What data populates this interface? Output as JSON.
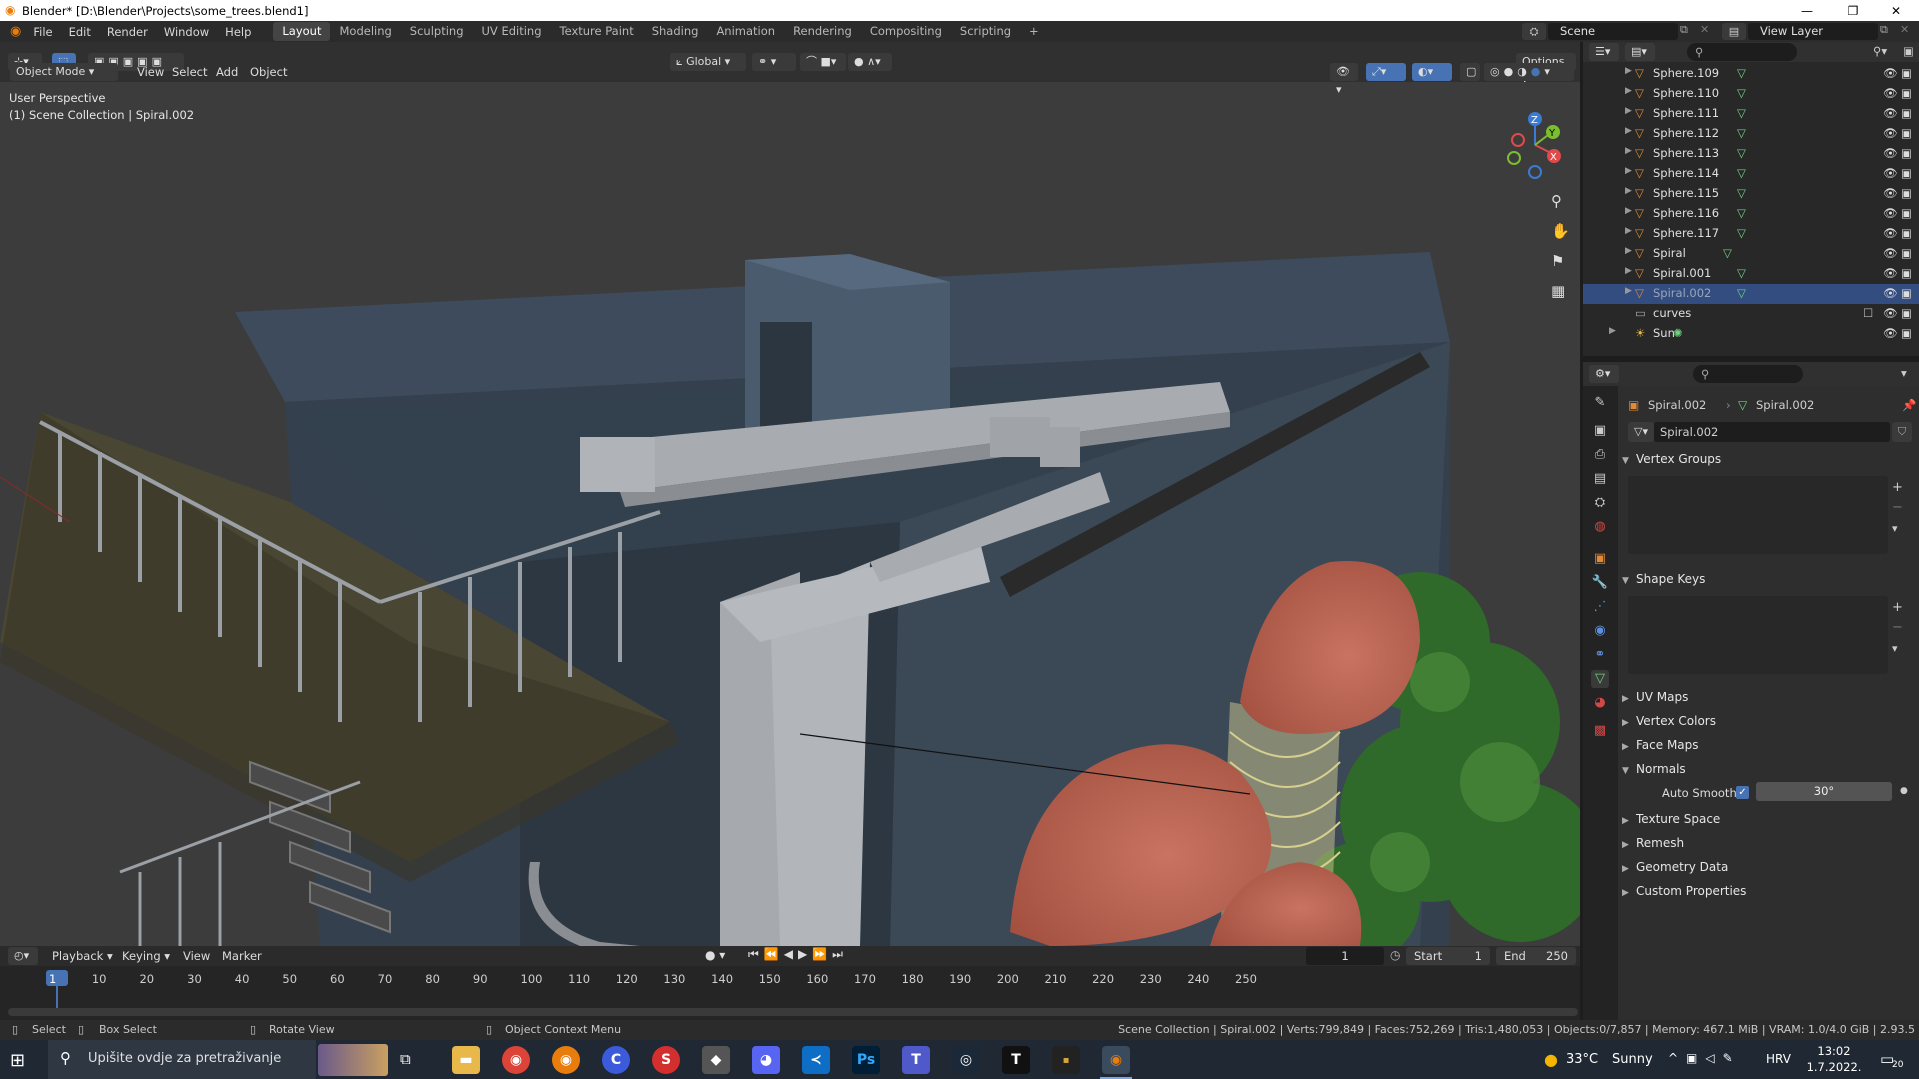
{
  "titlebar": {
    "title": "Blender* [D:\\Blender\\Projects\\some_trees.blend1]",
    "minimize": "—",
    "restore": "❐",
    "close": "✕"
  },
  "menus": [
    "File",
    "Edit",
    "Render",
    "Window",
    "Help"
  ],
  "workspaces": [
    {
      "label": "Layout",
      "active": true
    },
    {
      "label": "Modeling",
      "active": false
    },
    {
      "label": "Sculpting",
      "active": false
    },
    {
      "label": "UV Editing",
      "active": false
    },
    {
      "label": "Texture Paint",
      "active": false
    },
    {
      "label": "Shading",
      "active": false
    },
    {
      "label": "Animation",
      "active": false
    },
    {
      "label": "Rendering",
      "active": false
    },
    {
      "label": "Compositing",
      "active": false
    },
    {
      "label": "Scripting",
      "active": false
    }
  ],
  "add_workspace": "+",
  "scene": {
    "label": "Scene"
  },
  "view_layer": {
    "label": "View Layer"
  },
  "viewport_header": {
    "transform_orientation": "Global",
    "options": "Options",
    "mode": "Object Mode",
    "menus": [
      "View",
      "Select",
      "Add",
      "Object"
    ]
  },
  "viewport": {
    "perspective": "User Perspective",
    "collection": "(1) Scene Collection | Spiral.002"
  },
  "gizmo": {
    "z": "Z",
    "y": "Y",
    "x": "X"
  },
  "outliner": {
    "rows": [
      {
        "name": "Sphere.109",
        "type": "mesh",
        "selected": false
      },
      {
        "name": "Sphere.110",
        "type": "mesh",
        "selected": false
      },
      {
        "name": "Sphere.111",
        "type": "mesh",
        "selected": false
      },
      {
        "name": "Sphere.112",
        "type": "mesh",
        "selected": false
      },
      {
        "name": "Sphere.113",
        "type": "mesh",
        "selected": false
      },
      {
        "name": "Sphere.114",
        "type": "mesh",
        "selected": false
      },
      {
        "name": "Sphere.115",
        "type": "mesh",
        "selected": false
      },
      {
        "name": "Sphere.116",
        "type": "mesh",
        "selected": false
      },
      {
        "name": "Sphere.117",
        "type": "mesh",
        "selected": false
      },
      {
        "name": "Spiral",
        "type": "mesh",
        "selected": false
      },
      {
        "name": "Spiral.001",
        "type": "mesh",
        "selected": false
      },
      {
        "name": "Spiral.002",
        "type": "mesh",
        "selected": true
      },
      {
        "name": "curves",
        "type": "collection",
        "selected": false
      },
      {
        "name": "Sun",
        "type": "light",
        "selected": false
      }
    ]
  },
  "properties": {
    "object_name": "Spiral.002",
    "data_name": "Spiral.002",
    "mesh_field": "Spiral.002",
    "panels": {
      "vertex_groups": "Vertex Groups",
      "shape_keys": "Shape Keys",
      "uv_maps": "UV Maps",
      "vertex_colors": "Vertex Colors",
      "face_maps": "Face Maps",
      "normals": "Normals",
      "auto_smooth_label": "Auto Smooth",
      "auto_smooth_angle": "30°",
      "texture_space": "Texture Space",
      "remesh": "Remesh",
      "geometry_data": "Geometry Data",
      "custom_properties": "Custom Properties"
    }
  },
  "timeline": {
    "menus": [
      "Playback",
      "Keying",
      "View",
      "Marker"
    ],
    "current_frame": "1",
    "start_label": "Start",
    "start": "1",
    "end_label": "End",
    "end": "250",
    "ticks": [
      "1",
      "10",
      "20",
      "30",
      "40",
      "50",
      "60",
      "70",
      "80",
      "90",
      "100",
      "110",
      "120",
      "130",
      "140",
      "150",
      "160",
      "170",
      "180",
      "190",
      "200",
      "210",
      "220",
      "230",
      "240",
      "250"
    ]
  },
  "statusbar": {
    "select": "Select",
    "box_select": "Box Select",
    "rotate_view": "Rotate View",
    "context_menu": "Object Context Menu",
    "stats": "Scene Collection | Spiral.002 | Verts:799,849 | Faces:752,269 | Tris:1,480,053 | Objects:0/7,857 | Memory: 467.1 MiB | VRAM: 1.0/4.0 GiB | 2.93.5"
  },
  "taskbar": {
    "search_placeholder": "Upišite ovdje za pretraživanje",
    "weather_temp": "33°C",
    "weather_text": "Sunny",
    "language": "HRV",
    "time": "13:02",
    "date": "1.7.2022.",
    "notif_count": "20"
  },
  "colors": {
    "accent": "#4772b3",
    "selected_row": "#334d80",
    "mesh_icon": "#e08a35",
    "data_icon": "#6ed37e"
  }
}
